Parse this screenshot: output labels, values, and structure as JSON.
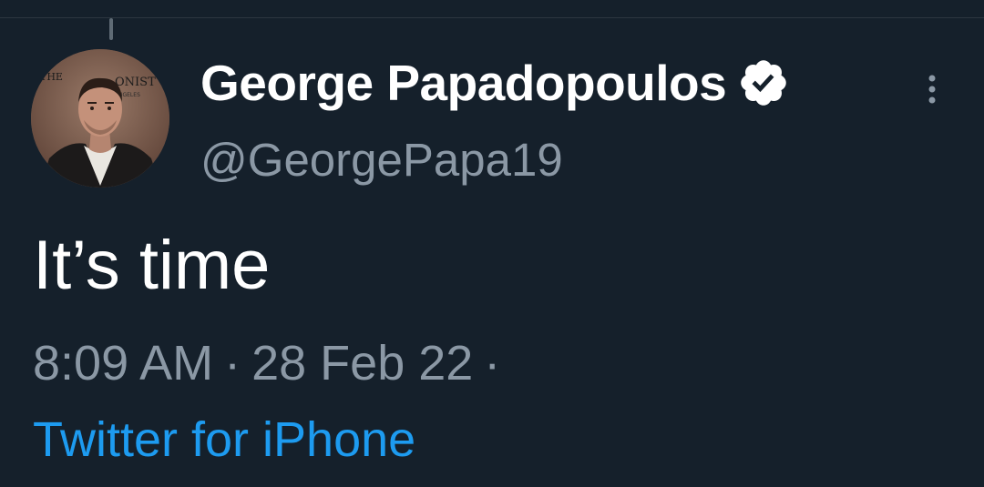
{
  "tweet": {
    "display_name": "George Papadopoulos",
    "handle": "@GeorgePapa19",
    "text": "It’s time",
    "time": "8:09 AM",
    "date": "28 Feb 22",
    "separator": "·",
    "source": "Twitter for iPhone",
    "verified": true
  },
  "avatar": {
    "backdrop_text_left": "THE",
    "backdrop_text_right": "ONIST",
    "backdrop_text_sub": "NGELES"
  },
  "icons": {
    "verified": "verified-badge-icon",
    "more": "more-vertical-icon"
  },
  "colors": {
    "background": "#15202b",
    "primary_text": "#ffffff",
    "secondary_text": "#8b98a5",
    "link": "#1d9bf0"
  }
}
